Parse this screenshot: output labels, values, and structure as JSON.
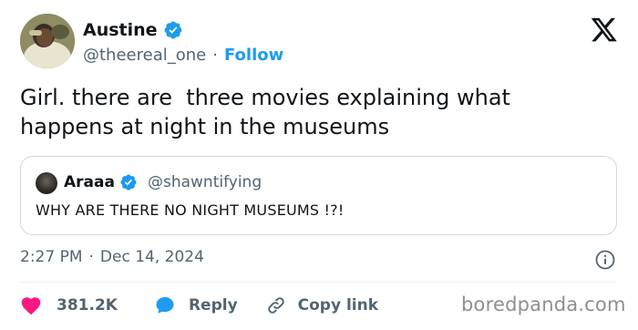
{
  "author": {
    "display_name": "Austine",
    "handle": "@theereal_one",
    "separator": "·",
    "follow_label": "Follow",
    "verified": true
  },
  "tweet": {
    "text": "Girl. there are  three movies explaining what happens at night in the museums"
  },
  "quote": {
    "display_name": "Araaa",
    "handle": "@shawntifying",
    "text": "WHY ARE THERE NO NIGHT MUSEUMS !?!",
    "verified": true
  },
  "meta": {
    "time": "2:27 PM",
    "separator": "·",
    "date": "Dec 14, 2024"
  },
  "actions": {
    "likes_count": "381.2K",
    "reply_label": "Reply",
    "copy_label": "Copy link"
  },
  "watermark": "boredpanda.com",
  "colors": {
    "accent": "#1d9bf0",
    "like": "#f91880",
    "secondary_text": "#536471"
  },
  "icons": {
    "brand": "x-logo-icon",
    "verified": "verified-badge-icon",
    "info": "info-icon",
    "like": "heart-icon",
    "reply": "reply-bubble-icon",
    "copy": "link-icon"
  }
}
